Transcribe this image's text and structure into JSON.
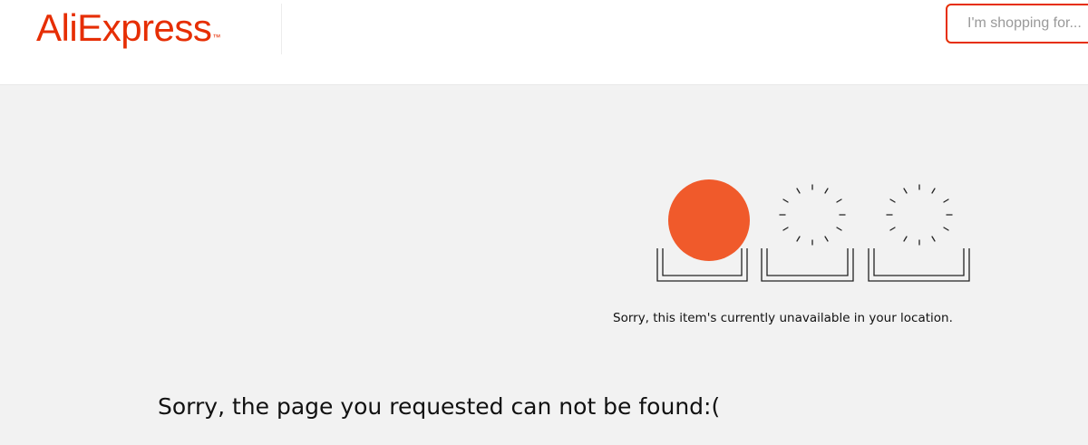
{
  "header": {
    "logo_text": "AliExpress",
    "logo_trademark": "™",
    "search_placeholder": "I'm shopping for..."
  },
  "main": {
    "unavailable_message": "Sorry, this item's currently unavailable in your location.",
    "not_found_message": "Sorry, the page you requested can not be found:("
  },
  "colors": {
    "brand": "#e62e04",
    "sun": "#f05a2b",
    "background": "#f2f2f2"
  },
  "icons": {
    "illustration": "sun-and-empty-slots-illustration"
  }
}
